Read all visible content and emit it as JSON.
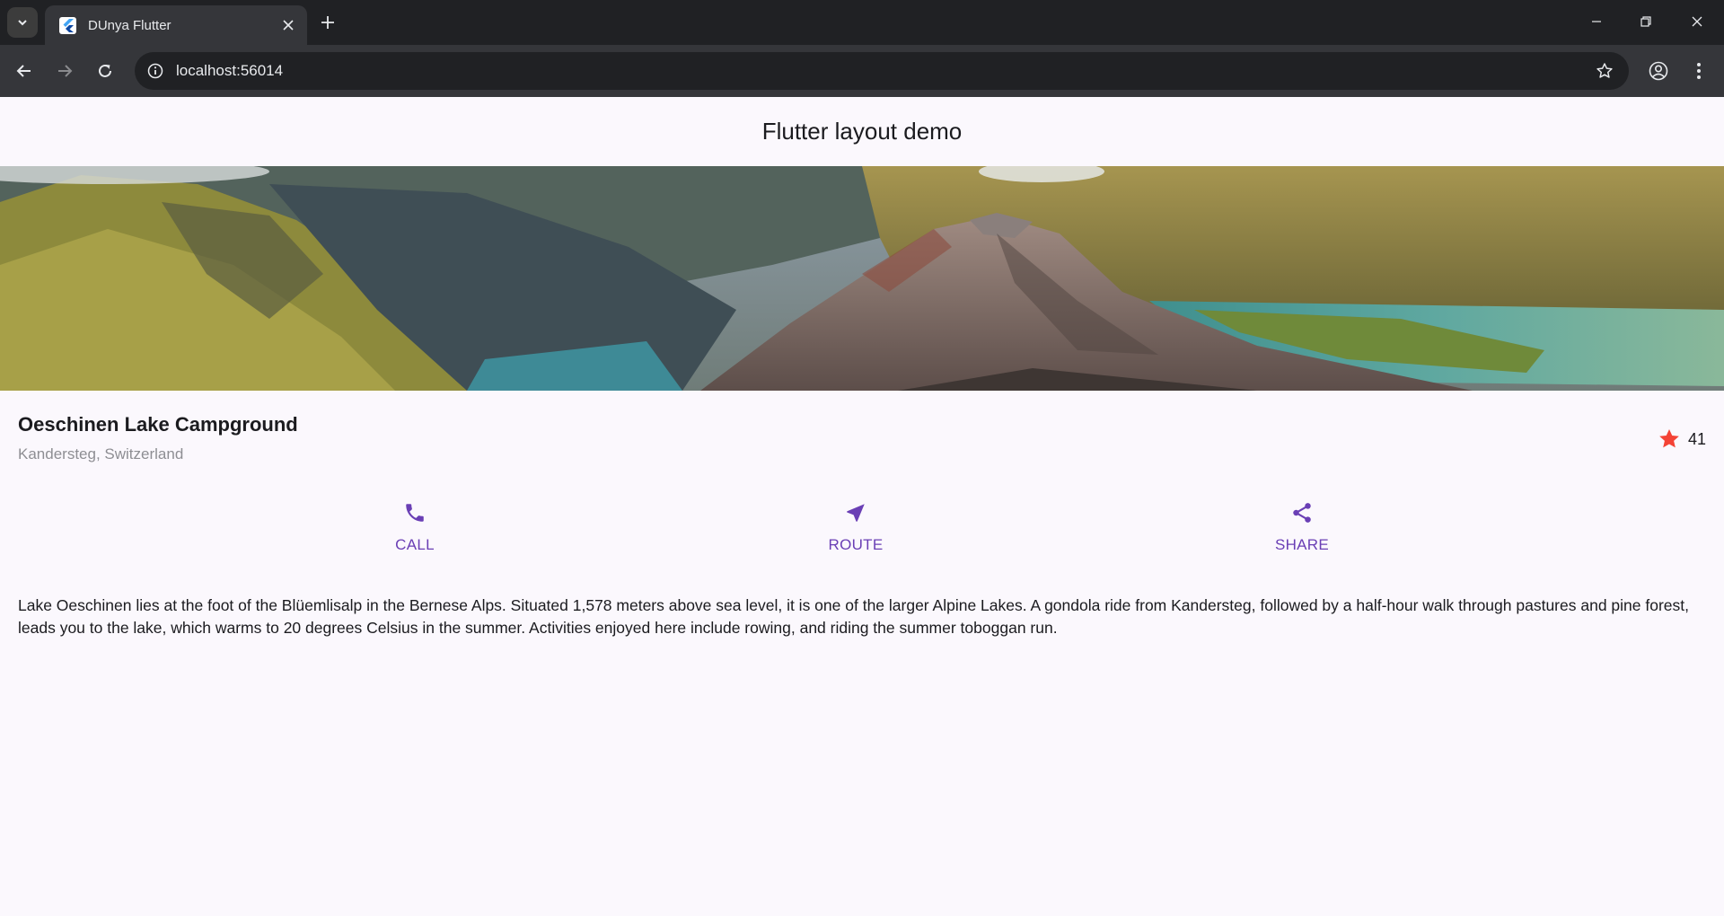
{
  "browser": {
    "tab_title": "DUnya Flutter",
    "url": "localhost:56014"
  },
  "app": {
    "title": "Flutter layout demo",
    "place": {
      "name": "Oeschinen Lake Campground",
      "location": "Kandersteg, Switzerland",
      "rating_count": "41",
      "rating_icon": "star-icon",
      "rating_color": "#f44336"
    },
    "actions": [
      {
        "label": "CALL",
        "icon": "phone-icon"
      },
      {
        "label": "ROUTE",
        "icon": "navigation-icon"
      },
      {
        "label": "SHARE",
        "icon": "share-icon"
      }
    ],
    "accent_color": "#6a3fb5",
    "description": "Lake Oeschinen lies at the foot of the Blüemlisalp in the Bernese Alps. Situated 1,578 meters above sea level, it is one of the larger Alpine Lakes. A gondola ride from Kandersteg, followed by a half-hour walk through pastures and pine forest, leads you to the lake, which warms to 20 degrees Celsius in the summer. Activities enjoyed here include rowing, and riding the summer toboggan run."
  }
}
